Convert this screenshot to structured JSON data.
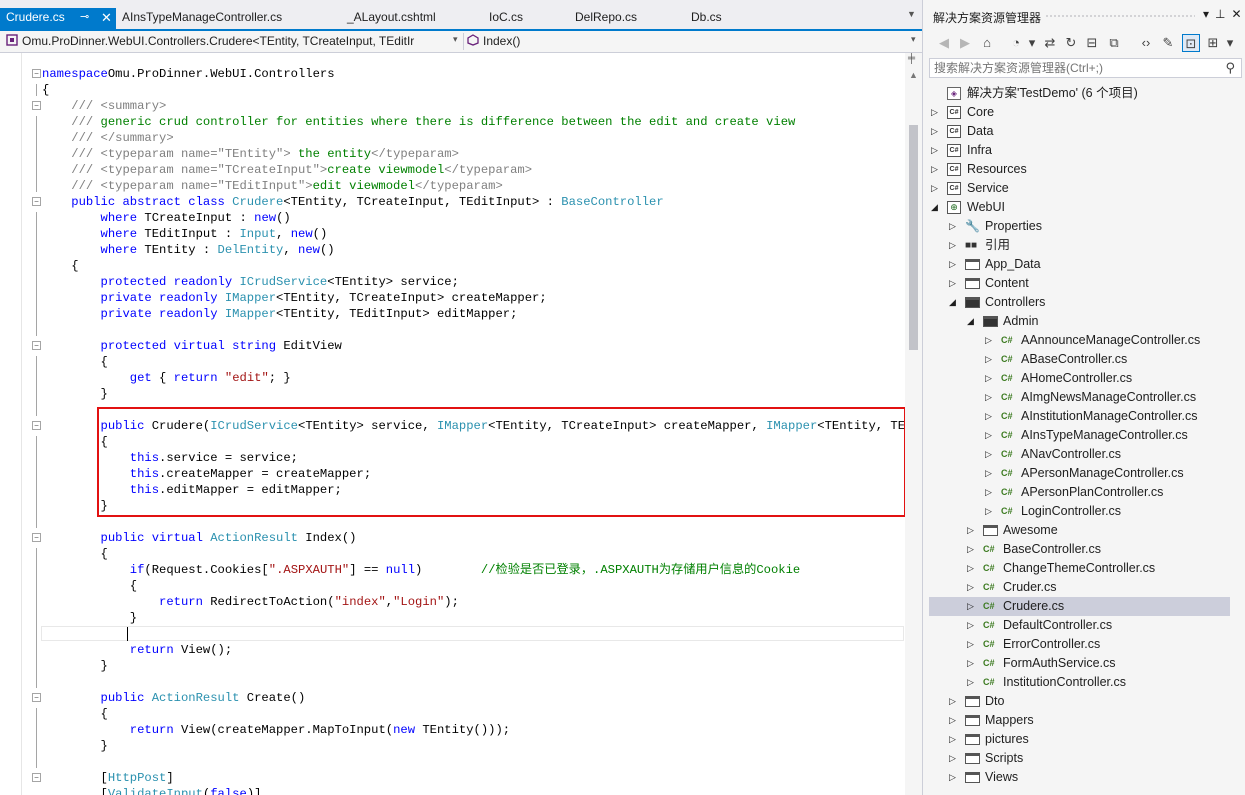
{
  "editor": {
    "tabs": [
      {
        "label": "Crudere.cs",
        "active": true
      },
      {
        "label": "AInsTypeManageController.cs"
      },
      {
        "label": "_ALayout.cshtml"
      },
      {
        "label": "IoC.cs"
      },
      {
        "label": "DelRepo.cs"
      },
      {
        "label": "Db.cs"
      }
    ],
    "nav_class": "Omu.ProDinner.WebUI.Controllers.Crudere<TEntity, TCreateInput, TEditIr",
    "nav_member": "Index()"
  },
  "solution_explorer": {
    "title": "解决方案资源管理器",
    "search_placeholder": "搜索解决方案资源管理器(Ctrl+;)",
    "solution": "解决方案'TestDemo' (6 个项目)",
    "projects": [
      "Core",
      "Data",
      "Infra",
      "Resources",
      "Service",
      "WebUI"
    ],
    "webui_items": [
      "Properties",
      "引用",
      "App_Data",
      "Content",
      "Controllers"
    ],
    "admin_folder": "Admin",
    "admin_files": [
      "AAnnounceManageController.cs",
      "ABaseController.cs",
      "AHomeController.cs",
      "AImgNewsManageController.cs",
      "AInstitutionManageController.cs",
      "AInsTypeManageController.cs",
      "ANavController.cs",
      "APersonManageController.cs",
      "APersonPlanController.cs",
      "LoginController.cs"
    ],
    "awesome_folder": "Awesome",
    "controller_files": [
      "BaseController.cs",
      "ChangeThemeController.cs",
      "Cruder.cs",
      "Crudere.cs",
      "DefaultController.cs",
      "ErrorController.cs",
      "FormAuthService.cs",
      "InstitutionController.cs"
    ],
    "more_folders": [
      "Dto",
      "Mappers",
      "pictures",
      "Scripts",
      "Views"
    ],
    "selected": "Crudere.cs"
  },
  "code_lines": [
    [
      [
        "kw",
        "namespace"
      ],
      [
        "",
        "Omu.ProDinner.WebUI.Controllers"
      ]
    ],
    [
      [
        "",
        "{"
      ]
    ],
    [
      [
        "dc",
        "    /// <summary>"
      ]
    ],
    [
      [
        "dc",
        "    /// "
      ],
      [
        "cm",
        "generic crud controller for entities where there is difference between the edit and create view"
      ]
    ],
    [
      [
        "dc",
        "    /// </summary>"
      ]
    ],
    [
      [
        "dc",
        "    /// <typeparam name=\"TEntity\">"
      ],
      [
        "cm",
        " the entity"
      ],
      [
        "dc",
        "</typeparam>"
      ]
    ],
    [
      [
        "dc",
        "    /// <typeparam name=\"TCreateInput\">"
      ],
      [
        "cm",
        "create viewmodel"
      ],
      [
        "dc",
        "</typeparam>"
      ]
    ],
    [
      [
        "dc",
        "    /// <typeparam name=\"TEditInput\">"
      ],
      [
        "cm",
        "edit viewmodel"
      ],
      [
        "dc",
        "</typeparam>"
      ]
    ],
    [
      [
        "kw",
        "    public abstract class "
      ],
      [
        "ty",
        "Crudere"
      ],
      [
        "",
        "<TEntity, TCreateInput, TEditInput> : "
      ],
      [
        "ty",
        "BaseController"
      ]
    ],
    [
      [
        "kw",
        "        where "
      ],
      [
        "",
        "TCreateInput : "
      ],
      [
        "kw",
        "new"
      ],
      [
        "",
        "()"
      ]
    ],
    [
      [
        "kw",
        "        where "
      ],
      [
        "",
        "TEditInput : "
      ],
      [
        "ty",
        "Input"
      ],
      [
        "",
        ", "
      ],
      [
        "kw",
        "new"
      ],
      [
        "",
        "()"
      ]
    ],
    [
      [
        "kw",
        "        where "
      ],
      [
        "",
        "TEntity : "
      ],
      [
        "ty",
        "DelEntity"
      ],
      [
        "",
        ", "
      ],
      [
        "kw",
        "new"
      ],
      [
        "",
        "()"
      ]
    ],
    [
      [
        "",
        "    {"
      ]
    ],
    [
      [
        "kw",
        "        protected readonly "
      ],
      [
        "ty",
        "ICrudService"
      ],
      [
        "",
        "<TEntity> service;"
      ]
    ],
    [
      [
        "kw",
        "        private readonly "
      ],
      [
        "ty",
        "IMapper"
      ],
      [
        "",
        "<TEntity, TCreateInput> createMapper;"
      ]
    ],
    [
      [
        "kw",
        "        private readonly "
      ],
      [
        "ty",
        "IMapper"
      ],
      [
        "",
        "<TEntity, TEditInput> editMapper;"
      ]
    ],
    [
      [
        "",
        ""
      ]
    ],
    [
      [
        "kw",
        "        protected virtual string "
      ],
      [
        "",
        "EditView"
      ]
    ],
    [
      [
        "",
        "        {"
      ]
    ],
    [
      [
        "kw",
        "            get "
      ],
      [
        "",
        "{ "
      ],
      [
        "kw",
        "return "
      ],
      [
        "st",
        "\"edit\""
      ],
      [
        "",
        "; }"
      ]
    ],
    [
      [
        "",
        "        }"
      ]
    ],
    [
      [
        "",
        ""
      ]
    ],
    [
      [
        "kw",
        "        public "
      ],
      [
        "",
        "Crudere("
      ],
      [
        "ty",
        "ICrudService"
      ],
      [
        "",
        "<TEntity> service, "
      ],
      [
        "ty",
        "IMapper"
      ],
      [
        "",
        "<TEntity, TCreateInput> createMapper, "
      ],
      [
        "ty",
        "IMapper"
      ],
      [
        "",
        "<TEntity, TEditIn"
      ]
    ],
    [
      [
        "",
        "        {"
      ]
    ],
    [
      [
        "kw",
        "            this"
      ],
      [
        "",
        ".service = service;"
      ]
    ],
    [
      [
        "kw",
        "            this"
      ],
      [
        "",
        ".createMapper = createMapper;"
      ]
    ],
    [
      [
        "kw",
        "            this"
      ],
      [
        "",
        ".editMapper = editMapper;"
      ]
    ],
    [
      [
        "",
        "        }"
      ]
    ],
    [
      [
        "",
        ""
      ]
    ],
    [
      [
        "kw",
        "        public virtual "
      ],
      [
        "ty",
        "ActionResult "
      ],
      [
        "",
        "Index()"
      ]
    ],
    [
      [
        "",
        "        {"
      ]
    ],
    [
      [
        "kw",
        "            if"
      ],
      [
        "",
        "(Request.Cookies["
      ],
      [
        "st",
        "\".ASPXAUTH\""
      ],
      [
        "",
        "] == "
      ],
      [
        "kw",
        "null"
      ],
      [
        "",
        ")        "
      ],
      [
        "cm",
        "//检验是否已登录，.ASPXAUTH为存储用户信息的Cookie"
      ]
    ],
    [
      [
        "",
        "            {"
      ]
    ],
    [
      [
        "kw",
        "                return "
      ],
      [
        "",
        "RedirectToAction("
      ],
      [
        "st",
        "\"index\""
      ],
      [
        "",
        ","
      ],
      [
        "st",
        "\"Login\""
      ],
      [
        "",
        ");"
      ]
    ],
    [
      [
        "",
        "            }"
      ]
    ],
    [
      [
        "",
        ""
      ]
    ],
    [
      [
        "kw",
        "            return "
      ],
      [
        "",
        "View();"
      ]
    ],
    [
      [
        "",
        "        }"
      ]
    ],
    [
      [
        "",
        ""
      ]
    ],
    [
      [
        "kw",
        "        public "
      ],
      [
        "ty",
        "ActionResult "
      ],
      [
        "",
        "Create()"
      ]
    ],
    [
      [
        "",
        "        {"
      ]
    ],
    [
      [
        "kw",
        "            return "
      ],
      [
        "",
        "View(createMapper.MapToInput("
      ],
      [
        "kw",
        "new "
      ],
      [
        "",
        "TEntity()));"
      ]
    ],
    [
      [
        "",
        "        }"
      ]
    ],
    [
      [
        "",
        ""
      ]
    ],
    [
      [
        "",
        "        ["
      ],
      [
        "ty",
        "HttpPost"
      ],
      [
        "",
        "]"
      ]
    ],
    [
      [
        "",
        "        ["
      ],
      [
        "ty",
        "ValidateInput"
      ],
      [
        "",
        "("
      ],
      [
        "kw",
        "false"
      ],
      [
        "",
        ")]"
      ]
    ]
  ]
}
